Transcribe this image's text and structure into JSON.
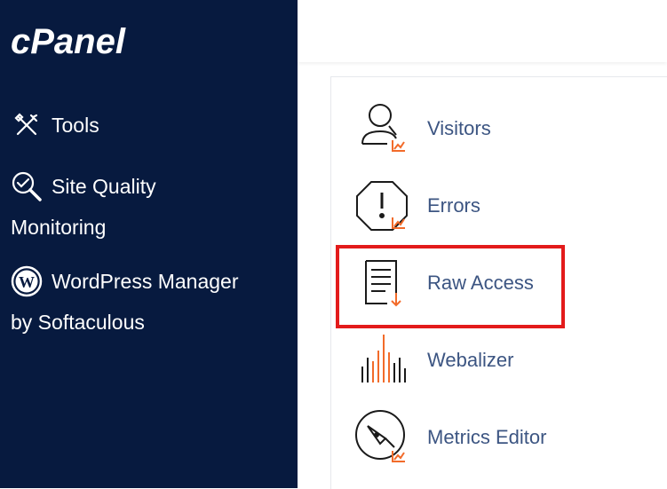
{
  "sidebar": {
    "logo_text": "cPanel",
    "items": [
      {
        "label_line1": "Tools",
        "label_line2": "",
        "icon": "tools-icon"
      },
      {
        "label_line1": "Site Quality",
        "label_line2": "Monitoring",
        "icon": "site-quality-icon"
      },
      {
        "label_line1": "WordPress Manager",
        "label_line2": "by Softaculous",
        "icon": "wordpress-icon"
      }
    ]
  },
  "apps": [
    {
      "label": "Visitors",
      "icon": "visitors-icon"
    },
    {
      "label": "Errors",
      "icon": "errors-icon"
    },
    {
      "label": "Raw Access",
      "icon": "raw-access-icon"
    },
    {
      "label": "Webalizer",
      "icon": "webalizer-icon"
    },
    {
      "label": "Metrics Editor",
      "icon": "metrics-editor-icon"
    }
  ],
  "colors": {
    "sidebar_bg": "#071a3f",
    "accent_orange": "#f26b2a",
    "label_blue": "#3c5582",
    "highlight_red": "#e31b1b"
  }
}
